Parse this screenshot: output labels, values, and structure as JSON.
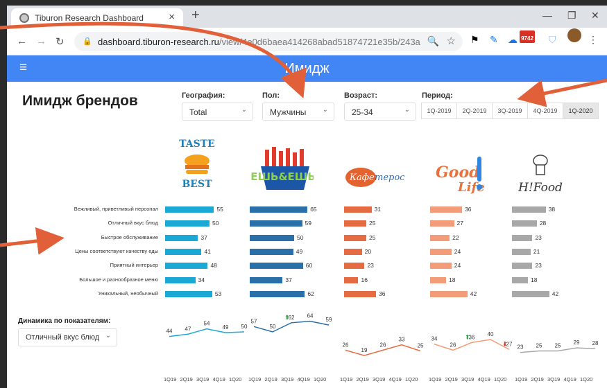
{
  "browser": {
    "tab_title": "Tiburon Research Dashboard",
    "url_main": "dashboard.tiburon-research.ru",
    "url_rest": "/view/4e0d6baea414268abad51874721e35b/243a",
    "gmail_badge": "9742"
  },
  "app": {
    "title": "Имидж"
  },
  "page": {
    "title": "Имидж брендов"
  },
  "filters": {
    "geo_label": "География:",
    "geo_value": "Total",
    "sex_label": "Пол:",
    "sex_value": "Мужчины",
    "age_label": "Возраст:",
    "age_value": "25-34",
    "period_label": "Период:",
    "periods": [
      "1Q-2019",
      "2Q-2019",
      "3Q-2019",
      "4Q-2019",
      "1Q-2020"
    ],
    "active_period": "1Q-2020"
  },
  "brands": [
    {
      "logo_text": "TASTE it BEST",
      "color": "#1ba8d4",
      "values": [
        55,
        50,
        37,
        41,
        48,
        34,
        53
      ]
    },
    {
      "logo_text": "ЕШЬ&ЕШЬ",
      "color": "#2a6fa8",
      "values": [
        65,
        59,
        50,
        49,
        60,
        37,
        62
      ]
    },
    {
      "logo_text": "Кафетерос",
      "color": "#e46b42",
      "values": [
        31,
        25,
        25,
        20,
        23,
        16,
        36
      ]
    },
    {
      "logo_text": "Good Life",
      "color": "#f39c79",
      "values": [
        36,
        27,
        22,
        24,
        24,
        18,
        42
      ]
    },
    {
      "logo_text": "H!Food",
      "color": "#a8a8a8",
      "values": [
        38,
        28,
        23,
        21,
        23,
        18,
        42
      ]
    }
  ],
  "attributes": [
    "Вежливый, приветливый персонал",
    "Отличный вкус блюд",
    "Быстрое обслуживание",
    "Цены соответствуют качеству еды",
    "Приятный интерьер",
    "Большое и разнообразное меню",
    "Уникальный, необычный"
  ],
  "dynamics": {
    "label": "Динамика по показателям:",
    "selected": "Отличный вкус блюд",
    "quarters": [
      "1Q19",
      "2Q19",
      "3Q19",
      "4Q19",
      "1Q20"
    ],
    "series": [
      {
        "values": [
          44,
          47,
          54,
          49,
          50
        ],
        "up": null,
        "down": null
      },
      {
        "values": [
          57,
          50,
          62,
          64,
          59
        ],
        "up": 2,
        "down": null
      },
      {
        "values": [
          26,
          19,
          26,
          33,
          25
        ],
        "up": null,
        "down": null
      },
      {
        "values": [
          34,
          26,
          36,
          40,
          27
        ],
        "up": 2,
        "down": 4
      },
      {
        "values": [
          23,
          25,
          25,
          29,
          28
        ],
        "up": null,
        "down": null
      }
    ]
  }
}
